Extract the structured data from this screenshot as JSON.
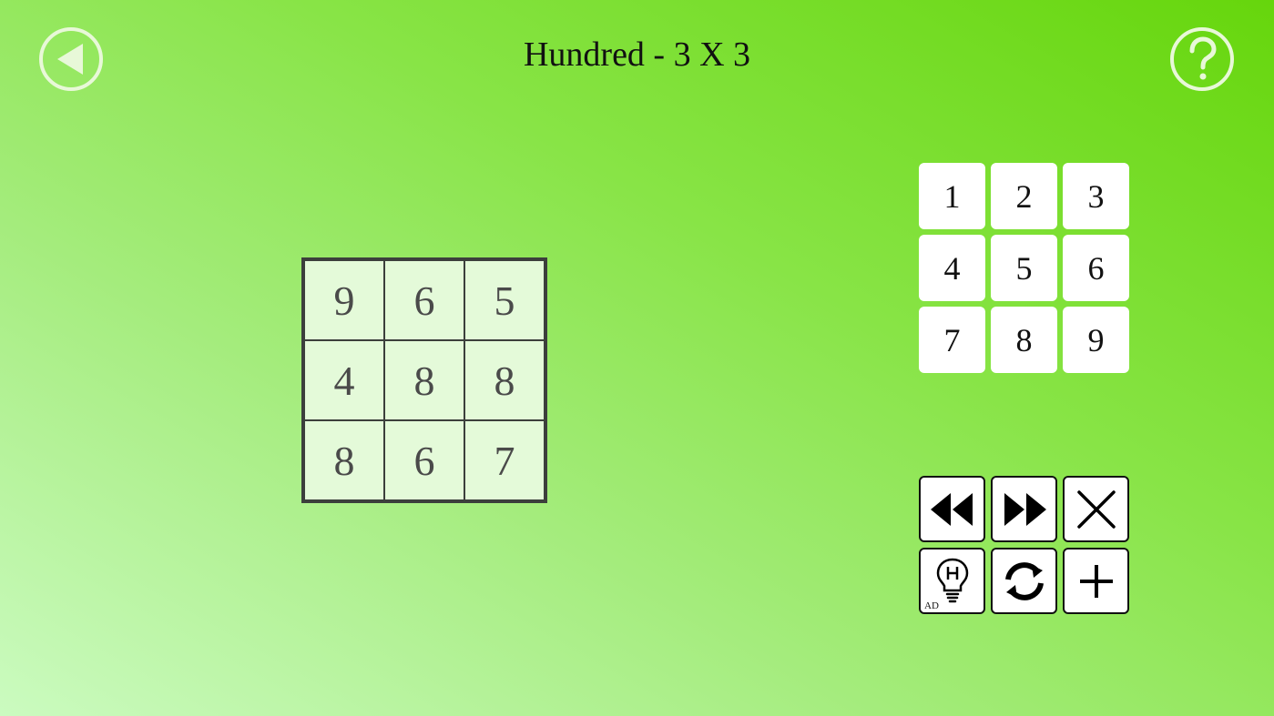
{
  "title": "Hundred - 3 X 3",
  "board": {
    "cells": [
      "9",
      "6",
      "5",
      "4",
      "8",
      "8",
      "8",
      "6",
      "7"
    ]
  },
  "keypad": {
    "keys": [
      "1",
      "2",
      "3",
      "4",
      "5",
      "6",
      "7",
      "8",
      "9"
    ]
  },
  "controls": {
    "hint_ad_label": "AD"
  },
  "icons": {
    "back": "back-arrow-icon",
    "help": "help-question-icon",
    "rewind": "rewind-icon",
    "fast_forward": "fast-forward-icon",
    "clear": "close-icon",
    "hint": "lightbulb-hint-icon",
    "restart": "refresh-icon",
    "new_game": "plus-icon"
  },
  "colors": {
    "background_start": "#cbfbc0",
    "background_end": "#66d60c",
    "board_cell": "#e4fad9",
    "grid_line": "#3c3f3c"
  }
}
